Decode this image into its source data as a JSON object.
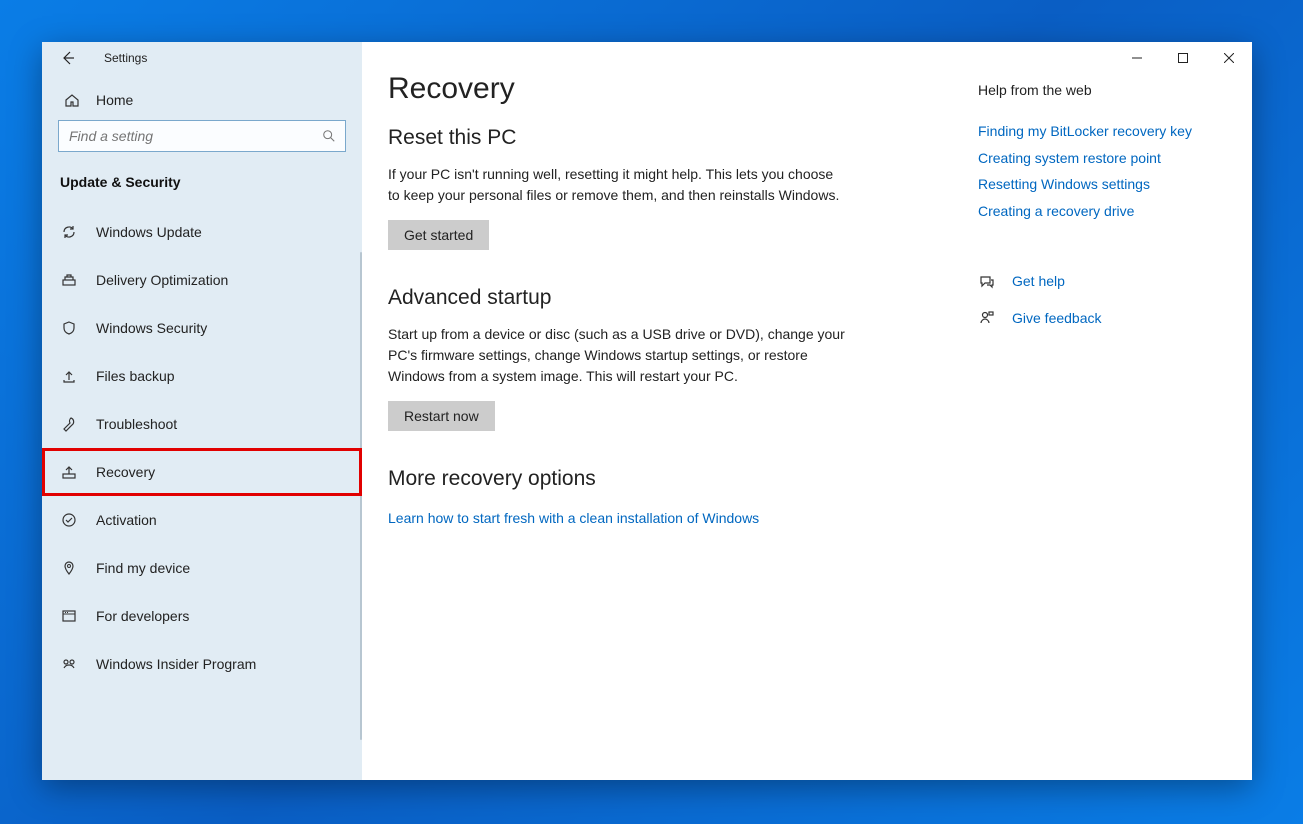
{
  "window_title": "Settings",
  "home_label": "Home",
  "search_placeholder": "Find a setting",
  "category_label": "Update & Security",
  "sidebar": {
    "items": [
      {
        "label": "Windows Update"
      },
      {
        "label": "Delivery Optimization"
      },
      {
        "label": "Windows Security"
      },
      {
        "label": "Files backup"
      },
      {
        "label": "Troubleshoot"
      },
      {
        "label": "Recovery"
      },
      {
        "label": "Activation"
      },
      {
        "label": "Find my device"
      },
      {
        "label": "For developers"
      },
      {
        "label": "Windows Insider Program"
      }
    ]
  },
  "page": {
    "title": "Recovery",
    "reset": {
      "heading": "Reset this PC",
      "body": "If your PC isn't running well, resetting it might help. This lets you choose to keep your personal files or remove them, and then reinstalls Windows.",
      "button": "Get started"
    },
    "advanced": {
      "heading": "Advanced startup",
      "body": "Start up from a device or disc (such as a USB drive or DVD), change your PC's firmware settings, change Windows startup settings, or restore Windows from a system image. This will restart your PC.",
      "button": "Restart now"
    },
    "more": {
      "heading": "More recovery options",
      "link": "Learn how to start fresh with a clean installation of Windows"
    }
  },
  "aside": {
    "heading": "Help from the web",
    "links": [
      "Finding my BitLocker recovery key",
      "Creating system restore point",
      "Resetting Windows settings",
      "Creating a recovery drive"
    ],
    "get_help": "Get help",
    "feedback": "Give feedback"
  }
}
